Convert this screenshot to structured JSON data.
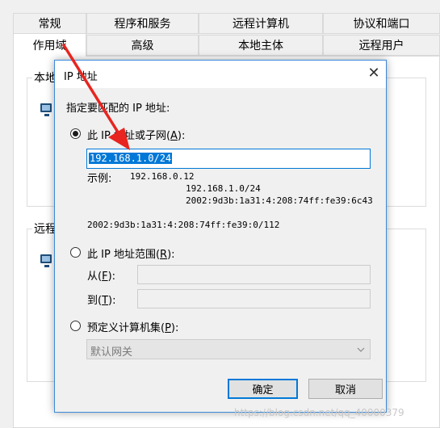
{
  "background_window": {
    "tabs_row1": [
      "常规",
      "程序和服务",
      "远程计算机",
      "协议和端口"
    ],
    "tabs_row2": [
      "作用域",
      "高级",
      "本地主体",
      "远程用户"
    ],
    "selected_tab": "作用域",
    "group_local_fragment": "本地",
    "group_remote_fragment": "远程"
  },
  "dialog": {
    "title": "IP 地址",
    "close_glyph": "✕",
    "prompt": "指定要匹配的 IP 地址:",
    "option_subnet": {
      "label": "此 IP 地址或子网(",
      "mnemonic": "A",
      "suffix": "):"
    },
    "subnet_value": "192.168.1.0/24",
    "example_label": "示例:",
    "examples": [
      "192.168.0.12",
      "192.168.1.0/24",
      "2002:9d3b:1a31:4:208:74ff:fe39:6c43"
    ],
    "example_extra": "2002:9d3b:1a31:4:208:74ff:fe39:0/112",
    "option_range": {
      "label": "此 IP 地址范围(",
      "mnemonic": "R",
      "suffix": "):"
    },
    "range_from": {
      "label": "从(",
      "mnemonic": "F",
      "suffix": "):"
    },
    "range_to": {
      "label": "到(",
      "mnemonic": "T",
      "suffix": "):"
    },
    "option_predefined": {
      "label": "预定义计算机集(",
      "mnemonic": "P",
      "suffix": "):"
    },
    "predefined_value": "默认网关",
    "ok_label": "确定",
    "cancel_label": "取消"
  },
  "watermark": "https://blog.csdn.net/qq_40000379",
  "colors": {
    "accent": "#0078d7",
    "arrow": "#e8251f",
    "dialog_border": "#3c8ad8"
  }
}
